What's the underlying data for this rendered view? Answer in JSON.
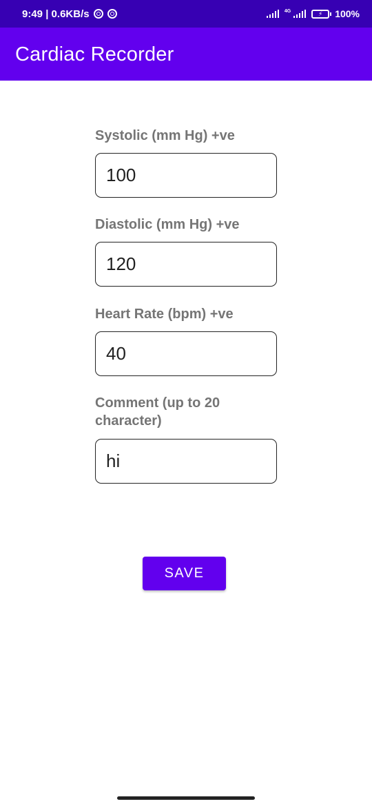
{
  "status_bar": {
    "time_speed": "9:49 | 0.6KB/s",
    "network_type": "4G",
    "battery": "100%",
    "icons": [
      "notification-circle-icon",
      "notification-circle-icon",
      "signal-icon",
      "signal-4g-icon",
      "battery-charging-icon"
    ]
  },
  "app_bar": {
    "title": "Cardiac Recorder"
  },
  "form": {
    "systolic": {
      "label": "Systolic (mm Hg) +ve",
      "value": "100"
    },
    "diastolic": {
      "label": "Diastolic (mm Hg) +ve",
      "value": "120"
    },
    "heart_rate": {
      "label": "Heart Rate (bpm) +ve",
      "value": "40"
    },
    "comment": {
      "label": "Comment (up to 20 character)",
      "value": "hi"
    },
    "save_label": "SAVE"
  },
  "colors": {
    "status_bar": "#3700b3",
    "app_bar": "#6200ee",
    "button": "#6200ee",
    "label": "#757575"
  }
}
